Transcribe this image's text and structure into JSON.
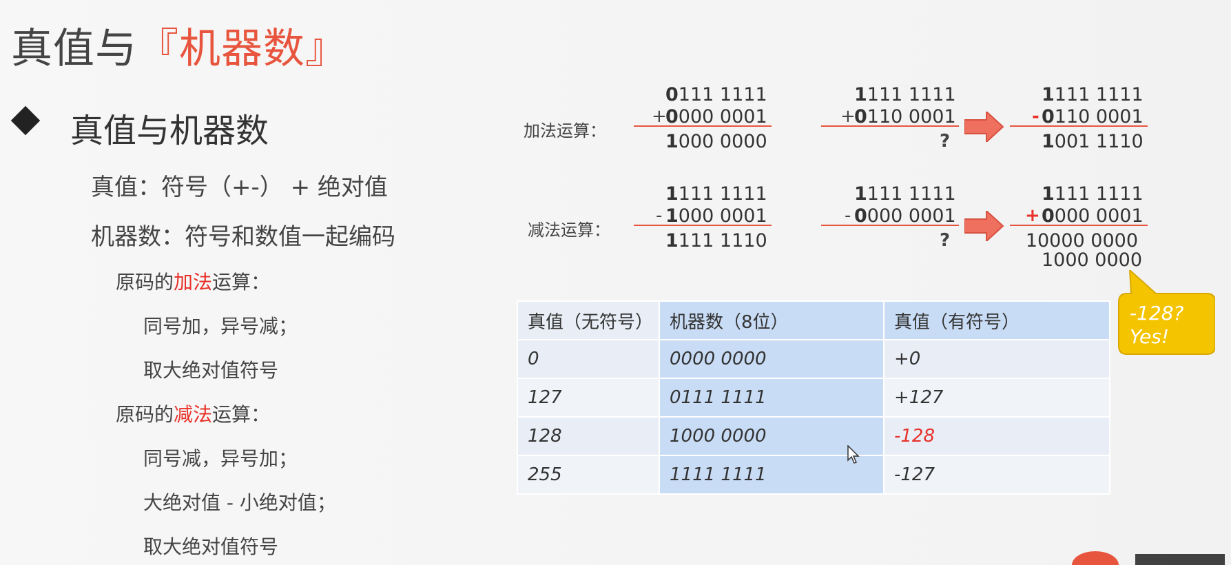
{
  "title": {
    "plain": "真值与",
    "accent": "『机器数』"
  },
  "heading": "真值与机器数",
  "lines": {
    "true_value": "真值：符号（+-）  + 绝对值",
    "machine_number": "机器数：符号和数值一起编码",
    "add_intro_prefix": "原码的",
    "add_intro_red": "加法",
    "add_intro_suffix": "运算：",
    "add_rule1": "同号加，异号减；",
    "add_rule2": "取大绝对值符号",
    "sub_intro_prefix": "原码的",
    "sub_intro_red": "减法",
    "sub_intro_suffix": "运算：",
    "sub_rule1": "同号减，异号加；",
    "sub_rule2": "大绝对值 - 小绝对值；",
    "sub_rule3": "取大绝对值符号"
  },
  "operations": {
    "add_label": "加法运算：",
    "sub_label": "减法运算：",
    "add1": {
      "a_bold": "0",
      "a_rest": "111 1111",
      "sign": "+",
      "b_bold": "0",
      "b_rest": "000 0001",
      "r_bold": "1",
      "r_rest": "000 0000"
    },
    "add2": {
      "a_bold": "1",
      "a_rest": "111 1111",
      "sign": "+",
      "b_bold": "0",
      "b_rest": "110 0001",
      "result": "?"
    },
    "add3": {
      "a_bold": "1",
      "a_rest": "111 1111",
      "sign": "-",
      "b_bold": "0",
      "b_rest": "110 0001",
      "r_bold": "1",
      "r_rest": "001 1110"
    },
    "sub1": {
      "a_bold": "1",
      "a_rest": "111 1111",
      "sign": "-",
      "b_bold": "1",
      "b_rest": "000 0001",
      "r_bold": "1",
      "r_rest": "111 1110"
    },
    "sub2": {
      "a_bold": "1",
      "a_rest": "111 1111",
      "sign": "-",
      "b_bold": "0",
      "b_rest": "000 0001",
      "result": "?"
    },
    "sub3": {
      "a_bold": "1",
      "a_rest": "111 1111",
      "sign": "+",
      "b_bold": "0",
      "b_rest": "000 0001",
      "r1": "10000 0000",
      "r2": "1000 0000"
    }
  },
  "table": {
    "headers": [
      "真值（无符号）",
      "机器数（8位）",
      "真值（有符号）"
    ],
    "rows": [
      [
        "0",
        "0000 0000",
        "+0"
      ],
      [
        "127",
        "0111 1111",
        "+127"
      ],
      [
        "128",
        "1000 0000",
        "-128"
      ],
      [
        "255",
        "1111 1111",
        "-127"
      ]
    ]
  },
  "callout": "-128?\nYes!",
  "colors": {
    "accent": "#e8553e",
    "red": "#e8312a",
    "callout": "#f5c400",
    "cell_blue": "#c9dcf5"
  }
}
